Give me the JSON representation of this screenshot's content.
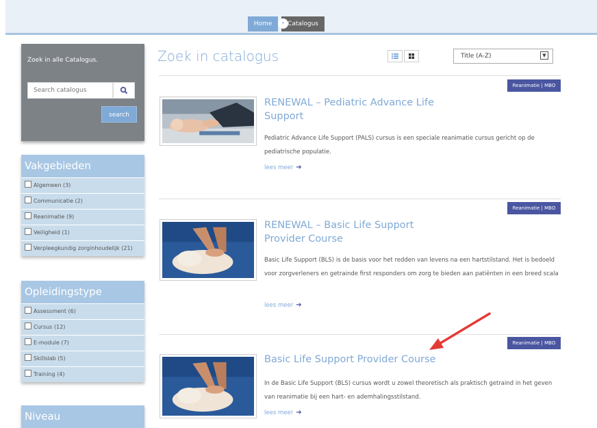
{
  "breadcrumb": {
    "home": "Home",
    "current": "Catalogus"
  },
  "sidebar": {
    "search_title": "Zoek in alle Catalogus.",
    "search_placeholder": "Search catalogus",
    "search_button": "search",
    "vakgebieden": {
      "title": "Vakgebieden",
      "items": [
        {
          "label": "Algemeen (3)"
        },
        {
          "label": "Communicatie (2)"
        },
        {
          "label": "Reanimatie (9)"
        },
        {
          "label": "Veiligheid (1)"
        },
        {
          "label": "Verpleegkundig zorginhoudelijk (21)"
        }
      ]
    },
    "opleidingstype": {
      "title": "Opleidingstype",
      "items": [
        {
          "label": "Assessment (6)"
        },
        {
          "label": "Cursus (12)"
        },
        {
          "label": "E-module (7)"
        },
        {
          "label": "Skillslab (5)"
        },
        {
          "label": "Training (4)"
        }
      ]
    },
    "niveau": {
      "title": "Niveau"
    }
  },
  "main": {
    "title": "Zoek in catalogus",
    "sort_selected": "Title (A-Z)",
    "courses": [
      {
        "badge": "Reanimatie | MBO",
        "title": "RENEWAL – Pediatric Advance Life Support",
        "desc": "Pediatric Advance Life Support (PALS) cursus is een speciale reanimatie cursus gericht op de pediatrische populatie.",
        "more": "lees meer"
      },
      {
        "badge": "Reanimatie | MBO",
        "title": "RENEWAL – Basic Life Support Provider Course",
        "desc": "Basic Life Support (BLS) is de basis voor het redden van levens na een hartstilstand. Het is bedoeld voor zorgverleners en getrainde first responders om zorg te bieden aan patiënten in een breed scala",
        "more": "lees meer"
      },
      {
        "badge": "Reanimatie | MBO",
        "title": "Basic Life Support Provider Course",
        "desc": "In de Basic Life Support (BLS) cursus wordt u zowel theoretisch als praktisch getraind in het geven van reanimatie bij een hart- en ademhalingsstilstand.",
        "more": "lees meer"
      }
    ]
  },
  "colors": {
    "accent": "#7fa9d6",
    "badge": "#4a56a0",
    "annotation_arrow": "#e53935"
  }
}
